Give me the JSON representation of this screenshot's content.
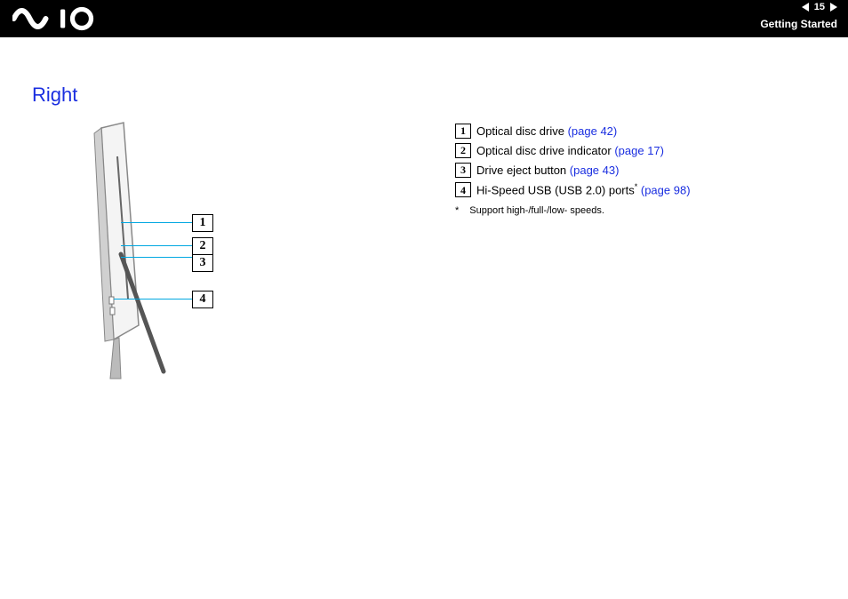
{
  "header": {
    "page_number": "15",
    "section": "Getting Started"
  },
  "title": "Right",
  "callouts": {
    "c1": "1",
    "c2": "2",
    "c3": "3",
    "c4": "4"
  },
  "legend": {
    "items": [
      {
        "num": "1",
        "text": "Optical disc drive ",
        "ref": "(page 42)"
      },
      {
        "num": "2",
        "text": "Optical disc drive indicator ",
        "ref": "(page 17)"
      },
      {
        "num": "3",
        "text": "Drive eject button ",
        "ref": "(page 43)"
      },
      {
        "num": "4",
        "text": "Hi-Speed USB (USB 2.0) ports",
        "sup": "*",
        "post": " ",
        "ref": "(page 98)"
      }
    ],
    "footnote_mark": "*",
    "footnote_text": "Support high-/full-/low- speeds."
  }
}
